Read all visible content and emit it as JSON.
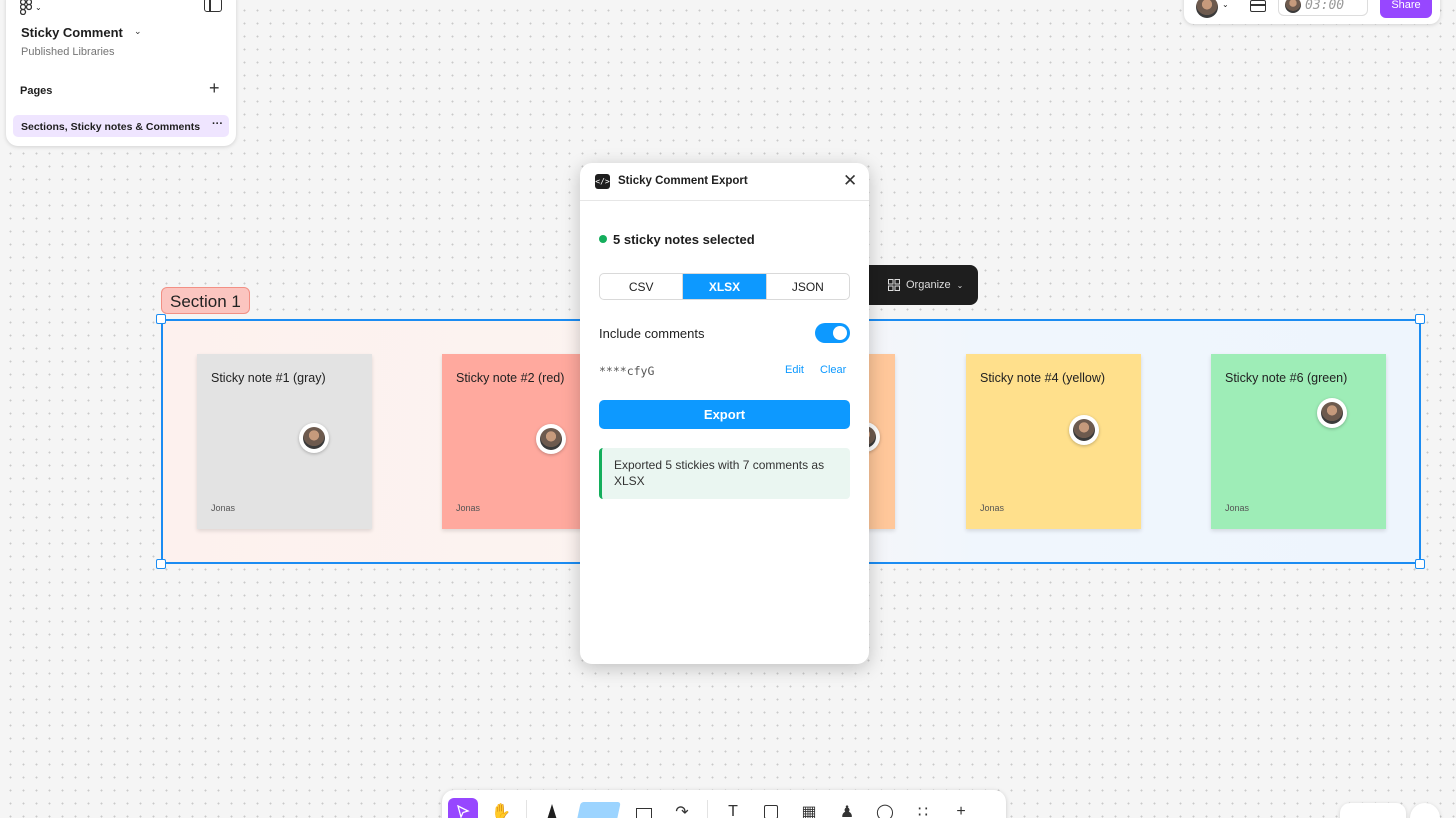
{
  "file": {
    "name": "Sticky Comment",
    "subtitle": "Published Libraries"
  },
  "pages": {
    "label": "Pages",
    "add": "+",
    "items": [
      {
        "label": "Sections, Sticky notes & Comments",
        "more": "···"
      }
    ]
  },
  "top_right": {
    "timer": "03:00",
    "share_label": "Share"
  },
  "section": {
    "label": "Section 1",
    "stickies": [
      {
        "title": "Sticky note #1 (gray)",
        "author": "Jonas",
        "color": "#e3e3e3"
      },
      {
        "title": "Sticky note #2 (red)",
        "author": "Jonas",
        "color": "#ffa99e"
      },
      {
        "title": "",
        "author": "",
        "color": "#ffc79a"
      },
      {
        "title": "Sticky note #4 (yellow)",
        "author": "Jonas",
        "color": "#ffe08c"
      },
      {
        "title": "Sticky note #6 (green)",
        "author": "Jonas",
        "color": "#9eedb7"
      }
    ]
  },
  "organize": {
    "label": "Organize"
  },
  "plugin": {
    "title": "Sticky Comment Export",
    "icon": "</>",
    "close": "✕",
    "status": "5 sticky notes selected",
    "formats": [
      "CSV",
      "XLSX",
      "JSON"
    ],
    "selected_format": "XLSX",
    "include_comments_label": "Include comments",
    "include_comments": true,
    "token": "****cfyG",
    "edit_label": "Edit",
    "clear_label": "Clear",
    "export_label": "Export",
    "result": "Exported 5 stickies with 7 comments as XLSX"
  },
  "colors": {
    "accent": "#0d99ff",
    "brand": "#9747ff",
    "success": "#14ae5c",
    "selection": "#1b8cf2"
  },
  "toolbar_icons": [
    "move-tool",
    "hand-tool",
    "marker-tool",
    "sticky-tool",
    "shape-tool",
    "connector-tool",
    "text-tool",
    "section-tool",
    "table-tool",
    "stamp-tool",
    "comment-tool",
    "widgets-tool",
    "more-tool"
  ]
}
